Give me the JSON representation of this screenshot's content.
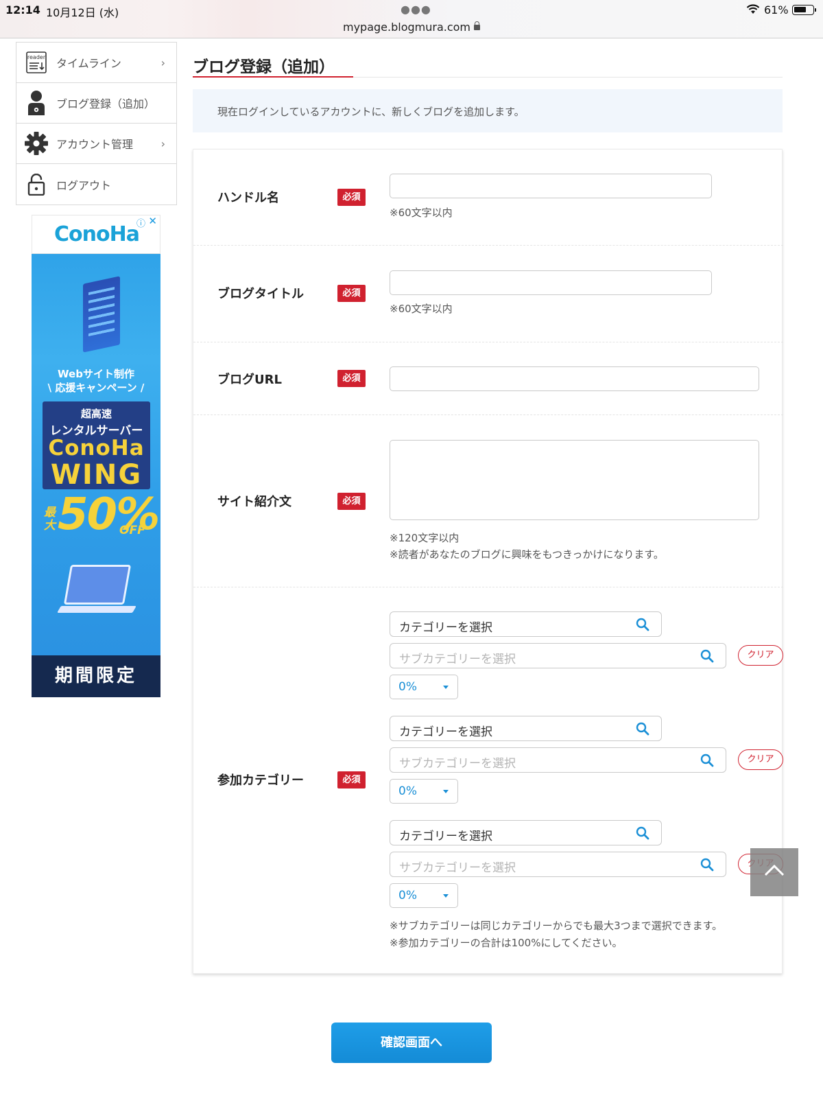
{
  "status_bar": {
    "time": "12:14",
    "date": "10月12日 (水)",
    "url": "mypage.blogmura.com",
    "battery": "61%",
    "battery_level": 0.61
  },
  "sidebar": {
    "items": [
      {
        "label": "タイムライン",
        "icon": "reader-icon",
        "has_chevron": true
      },
      {
        "label": "ブログ登録（追加）",
        "icon": "user-icon",
        "has_chevron": false
      },
      {
        "label": "アカウント管理",
        "icon": "gear-icon",
        "has_chevron": true
      },
      {
        "label": "ログアウト",
        "icon": "lock-icon",
        "has_chevron": false
      }
    ],
    "chevron": "›",
    "reader_icon_text": "reader"
  },
  "ad": {
    "logo": "ConoHa",
    "line1": "Webサイト制作",
    "line2": "\\ 応援キャンペーン /",
    "panel1": "超高速",
    "panel2": "レンタルサーバー",
    "panel3": "ConoHa",
    "panel4": "WING",
    "discount_pre": "最大",
    "discount": "50%",
    "discount_post": "OFF",
    "bottom": "期間限定",
    "accent_color": "#f6d23a"
  },
  "page": {
    "title": "ブログ登録（追加）",
    "intro": "現在ログインしているアカウントに、新しくブログを追加します。",
    "required_badge": "必須",
    "accent_color": "#d0212f",
    "link_color": "#1a8fd6"
  },
  "form": {
    "handle_label": "ハンドル名",
    "handle_value": "",
    "handle_hint": "※60文字以内",
    "title_label": "ブログタイトル",
    "title_value": "",
    "title_hint": "※60文字以内",
    "url_label": "ブログURL",
    "url_value": "",
    "desc_label": "サイト紹介文",
    "desc_value": "",
    "desc_hint1": "※120文字以内",
    "desc_hint2": "※読者があなたのブログに興味をもつきっかけになります。",
    "cat_label": "参加カテゴリー",
    "category_groups": [
      {
        "category": "カテゴリーを選択",
        "subcategory": "サブカテゴリーを選択",
        "clear": "クリア",
        "percent": "0%"
      },
      {
        "category": "カテゴリーを選択",
        "subcategory": "サブカテゴリーを選択",
        "clear": "クリア",
        "percent": "0%"
      },
      {
        "category": "カテゴリーを選択",
        "subcategory": "サブカテゴリーを選択",
        "clear": "クリア",
        "percent": "0%"
      }
    ],
    "cat_hint1": "※サブカテゴリーは同じカテゴリーからでも最大3つまで選択できます。",
    "cat_hint2": "※参加カテゴリーの合計は100%にしてください。"
  },
  "submit_label": "確認画面へ"
}
